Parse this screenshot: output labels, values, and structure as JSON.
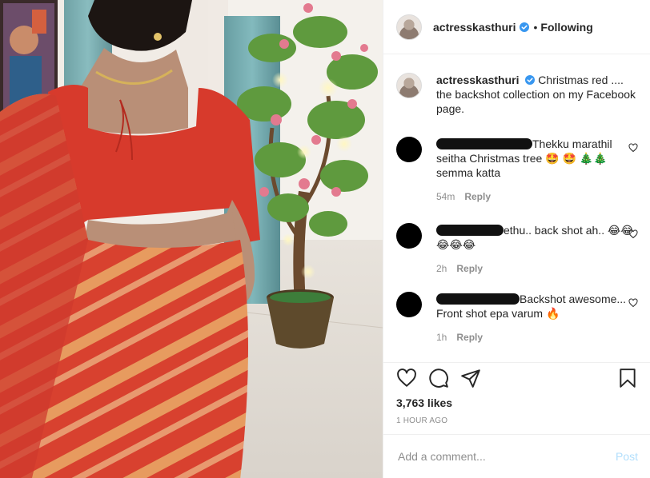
{
  "header": {
    "username": "actresskasthuri",
    "separator": "•",
    "follow_state": "Following"
  },
  "caption": {
    "username": "actresskasthuri",
    "text": "Christmas red .... the backshot collection on my Facebook page."
  },
  "comments": [
    {
      "text": "Thekku marathil seitha Christmas tree 🤩 🤩 🎄🎄 semma katta",
      "time": "54m",
      "reply_label": "Reply"
    },
    {
      "text": "ethu.. back shot ah.. 😂😂😂😂😂",
      "time": "2h",
      "reply_label": "Reply"
    },
    {
      "text": "Backshot awesome... Front shot epa varum 🔥",
      "time": "1h",
      "reply_label": "Reply"
    }
  ],
  "actions": {
    "likes": "3,763 likes",
    "time_ago": "1 hour ago"
  },
  "add_comment": {
    "placeholder": "Add a comment...",
    "post_label": "Post"
  },
  "icons": {
    "verified": "verified-badge-icon",
    "like": "heart-icon",
    "comment": "comment-bubble-icon",
    "share": "paper-plane-icon",
    "save": "bookmark-icon",
    "comment_like": "small-heart-icon"
  },
  "colors": {
    "verified_blue": "#3897f0",
    "text_primary": "#262626",
    "text_secondary": "#8e8e8e",
    "post_button": "#b2dffc",
    "saree_red": "#d8402f",
    "saree_gold": "#e6a15a"
  }
}
